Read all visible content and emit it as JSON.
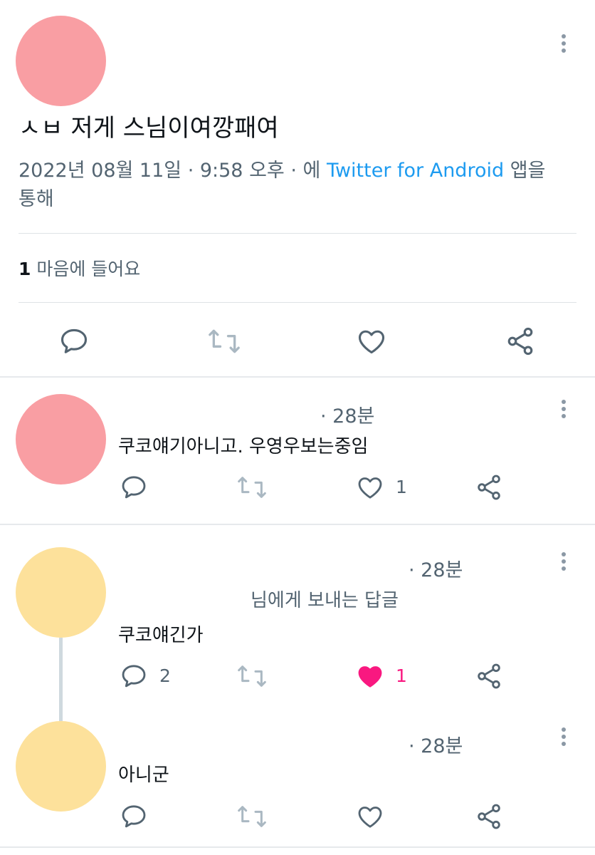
{
  "main_tweet": {
    "text": "ㅅㅂ 저게 스님이여깡패여",
    "date": "2022년 08월 11일 · 9:58 오후 · 에",
    "source": "Twitter for Android",
    "source_suffix_1": "앱을",
    "source_suffix_2": "통해",
    "likes_count": "1",
    "likes_label": "마음에 들어요",
    "avatar_color": "#f99ea3"
  },
  "replies": [
    {
      "time": "· 28분",
      "text": "쿠코얘기아니고. 우영우보는중임",
      "like_count": "1",
      "avatar_color": "#f99ea3"
    },
    {
      "time": "· 28분",
      "replying_to": "님에게 보내는 답글",
      "text": "쿠코얘긴가",
      "reply_count": "2",
      "like_count": "1",
      "liked": true,
      "avatar_color": "#fde19b"
    },
    {
      "time": "· 28분",
      "text": "아니군",
      "avatar_color": "#fde19b"
    }
  ],
  "colors": {
    "link": "#1d9bf0",
    "like_active": "#f91880",
    "icon_gray": "#536471",
    "retweet_gray": "#aab8c2"
  },
  "icons": [
    "reply-icon",
    "retweet-icon",
    "like-icon",
    "share-icon",
    "more-icon"
  ]
}
